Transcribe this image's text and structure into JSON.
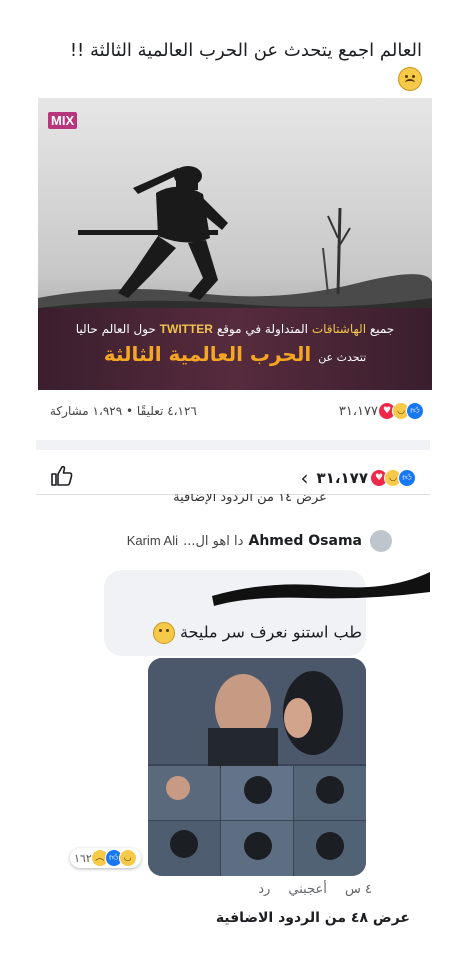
{
  "post": {
    "text": "العالم اجمع يتحدث عن الحرب العالمية الثالثة !!",
    "emoji_icon": "sad-face-emoji"
  },
  "image": {
    "logo": "MIX",
    "caption_part1": "جميع",
    "caption_hashtags": "الهاشتاقات",
    "caption_part2": "المتداولة في موقع",
    "caption_twitter": "TWITTER",
    "caption_part3": "حول العالم حاليا",
    "caption_small": "تتحدث عن",
    "caption_big": "الحرب العالمية الثالثة"
  },
  "stats": {
    "reactions_count": "٣١،١٧٧",
    "comments_shares": "٤،١٢٦ تعليقًا • ١،٩٢٩ مشاركة",
    "reaction_icons": [
      "like-icon",
      "haha-icon",
      "love-icon"
    ]
  },
  "comments_header": {
    "reactions_count": "٣١،١٧٧",
    "back_icon": "chevron-left-icon",
    "like_icon": "thumbs-up-icon"
  },
  "thread": {
    "view_more_top": "عرض ١٤ من الردود الإضافية",
    "reply_author": "Ahmed Osama",
    "reply_snippet": "دا اهو ال...",
    "reply_tag": "Karim Ali",
    "comment_text": "طب استنو نعرف سر مليحة",
    "reply_reaction_count": "١٦٢",
    "reply_reaction_icons": [
      "haha-icon",
      "like-icon",
      "sad-icon"
    ],
    "time": "٤ س",
    "like_label": "أعجبني",
    "reply_label": "رد",
    "view_more_bottom": "عرض ٤٨ من الردود الاضافية"
  },
  "colors": {
    "facebook_blue": "#1877f2",
    "love_red": "#f02849",
    "emoji_yellow": "#f7c948",
    "caption_orange": "#f5a623"
  }
}
